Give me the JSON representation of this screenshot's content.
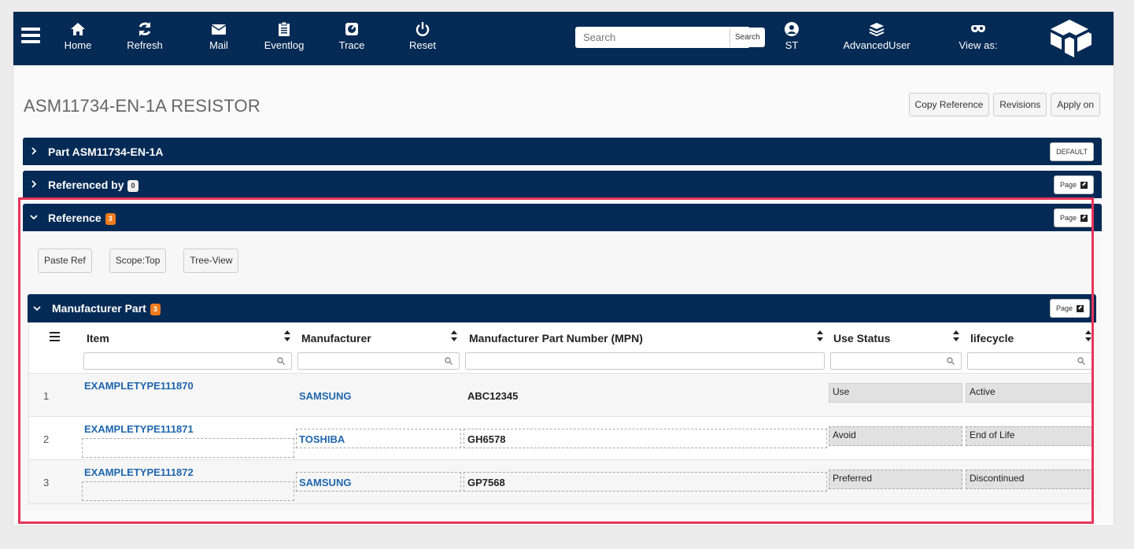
{
  "navbar": {
    "items": [
      {
        "label": "Home",
        "icon": "home-icon"
      },
      {
        "label": "Refresh",
        "icon": "refresh-icon"
      },
      {
        "label": "Mail",
        "icon": "mail-icon"
      },
      {
        "label": "Eventlog",
        "icon": "eventlog-icon"
      },
      {
        "label": "Trace",
        "icon": "trace-icon"
      },
      {
        "label": "Reset",
        "icon": "power-icon"
      }
    ],
    "search_placeholder": "Search",
    "search_button": "Search",
    "user": {
      "label": "ST",
      "icon": "user-icon"
    },
    "role": {
      "label": "AdvancedUser",
      "icon": "layers-icon"
    },
    "view_as": {
      "label": "View as:",
      "icon": "mask-icon"
    },
    "brand_color": "#052a55"
  },
  "page": {
    "title": "ASM11734-EN-1A RESISTOR",
    "actions": [
      "Copy Reference",
      "Revisions",
      "Apply on"
    ]
  },
  "panels": {
    "part": {
      "title": "Part ASM11734-EN-1A",
      "button": "DEFAULT"
    },
    "referenced_by": {
      "title": "Referenced by",
      "count": "0",
      "button": "Page"
    },
    "reference": {
      "title": "Reference",
      "count": "3",
      "button": "Page"
    }
  },
  "reference_actions": [
    "Paste Ref",
    "Scope:Top",
    "Tree-View"
  ],
  "manufacturer_part": {
    "title": "Manufacturer Part",
    "count": "3",
    "button": "Page",
    "columns": [
      "Item",
      "Manufacturer",
      "Manufacturer Part Number (MPN)",
      "Use Status",
      "lifecycle"
    ],
    "rows": [
      {
        "num": "1",
        "item": "EXAMPLETYPE111870",
        "manufacturer": "SAMSUNG",
        "mpn": "ABC12345",
        "use_status": "Use",
        "lifecycle": "Active"
      },
      {
        "num": "2",
        "item": "EXAMPLETYPE111871",
        "manufacturer": "TOSHIBA",
        "mpn": "GH6578",
        "use_status": "Avoid",
        "lifecycle": "End of Life"
      },
      {
        "num": "3",
        "item": "EXAMPLETYPE111872",
        "manufacturer": "SAMSUNG",
        "mpn": "GP7568",
        "use_status": "Preferred",
        "lifecycle": "Discontinued"
      }
    ]
  },
  "accent": {
    "badge": "#f07b1d",
    "link": "#1f66ad",
    "highlight": "#e8345a"
  }
}
